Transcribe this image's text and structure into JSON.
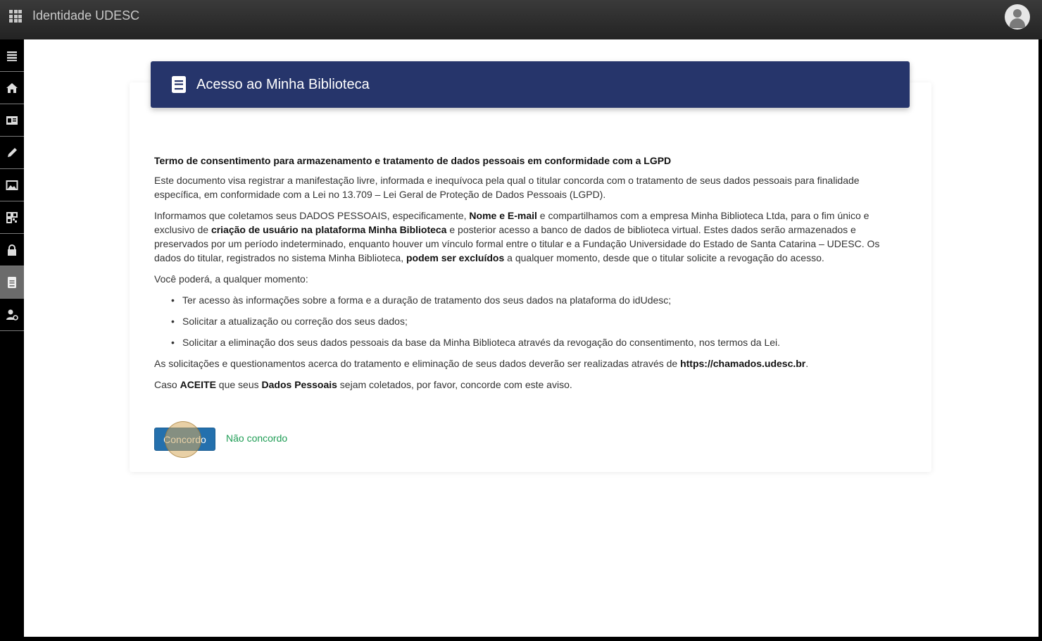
{
  "app": {
    "title": "Identidade UDESC"
  },
  "icons": {
    "apps": "apps-grid-icon",
    "user": "user-avatar-icon",
    "book": "book-icon"
  },
  "colors": {
    "header": "#26356b",
    "primary": "#2470ad",
    "link": "#1f9d55"
  },
  "sidebar": {
    "items": [
      {
        "name": "menu-icon"
      },
      {
        "name": "home-icon"
      },
      {
        "name": "id-card-icon"
      },
      {
        "name": "pencil-icon"
      },
      {
        "name": "image-icon"
      },
      {
        "name": "qr-code-icon"
      },
      {
        "name": "lock-icon"
      },
      {
        "name": "book-icon",
        "active": true
      },
      {
        "name": "user-settings-icon"
      }
    ]
  },
  "card": {
    "title": "Acesso ao Minha Biblioteca",
    "heading": "Termo de consentimento para armazenamento e tratamento de dados pessoais em conformidade com a LGPD",
    "p1": "Este documento visa registrar a manifestação livre, informada e inequívoca pela qual o titular concorda com o tratamento de seus dados pessoais para finalidade específica, em conformidade com a Lei no 13.709 – Lei Geral de Proteção de Dados Pessoais (LGPD).",
    "p2": {
      "a": "Informamos que coletamos seus DADOS PESSOAIS, especificamente, ",
      "b": "Nome e E-mail",
      "c": " e compartilhamos com a empresa Minha Biblioteca Ltda, para o fim único e exclusivo de ",
      "d": "criação de usuário na plataforma Minha Biblioteca",
      "e": " e posterior acesso a banco de dados de biblioteca virtual. Estes dados serão armazenados e preservados por um período indeterminado, enquanto houver um vínculo formal entre o titular e a Fundação Universidade do Estado de Santa Catarina – UDESC. Os dados do titular, registrados no sistema Minha Biblioteca, ",
      "f": "podem ser excluídos",
      "g": " a qualquer momento, desde que o titular solicite a revogação do acesso."
    },
    "p3": "Você poderá, a qualquer momento:",
    "list": [
      "Ter acesso às informações sobre a forma e a duração de tratamento dos seus dados na plataforma do idUdesc;",
      "Solicitar a atualização ou correção dos seus dados;",
      "Solicitar a eliminação dos seus dados pessoais da base da Minha Biblioteca através da revogação do consentimento, nos termos da Lei."
    ],
    "p4": {
      "a": "As solicitações e questionamentos acerca do tratamento e eliminação de seus dados deverão ser realizadas através de ",
      "b": "https://chamados.udesc.br",
      "c": "."
    },
    "p5": {
      "a": "Caso ",
      "b": "ACEITE",
      "c": " que seus ",
      "d": "Dados Pessoais",
      "e": " sejam coletados, por favor, concorde com este aviso."
    },
    "agree_label": "Concordo",
    "disagree_label": "Não concordo"
  }
}
